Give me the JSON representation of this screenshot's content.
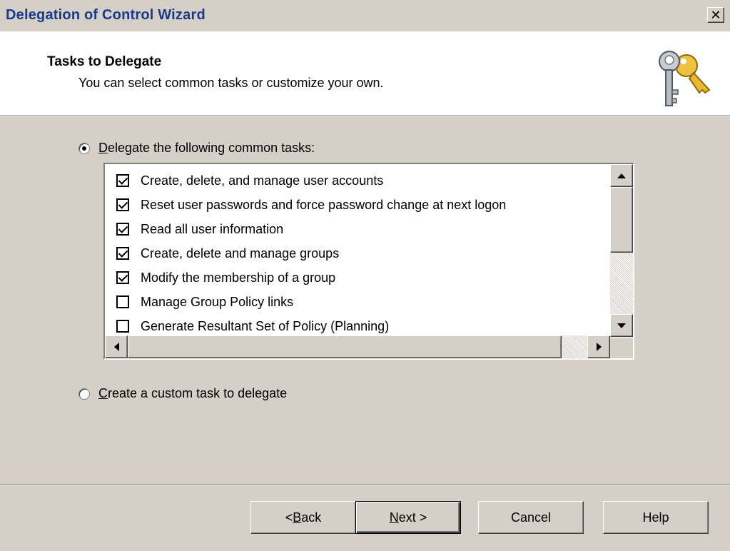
{
  "window": {
    "title": "Delegation of Control Wizard",
    "close_glyph": "✕"
  },
  "header": {
    "title": "Tasks to Delegate",
    "subtitle": "You can select common tasks or customize your own.",
    "icon": "keys-icon"
  },
  "options": {
    "common": {
      "accel": "D",
      "rest": "elegate the following common tasks:",
      "selected": true
    },
    "custom": {
      "accel": "C",
      "rest": "reate a custom task to delegate",
      "selected": false
    }
  },
  "tasks": [
    {
      "label": "Create, delete, and manage user accounts",
      "checked": true
    },
    {
      "label": "Reset user passwords and force password change at next logon",
      "checked": true
    },
    {
      "label": "Read all user information",
      "checked": true
    },
    {
      "label": "Create, delete and manage groups",
      "checked": true
    },
    {
      "label": "Modify the membership of a group",
      "checked": true
    },
    {
      "label": "Manage Group Policy links",
      "checked": false
    },
    {
      "label": "Generate Resultant Set of Policy (Planning)",
      "checked": false
    }
  ],
  "buttons": {
    "back_prefix": "< ",
    "back_accel": "B",
    "back_rest": "ack",
    "next_accel": "N",
    "next_rest": "ext >",
    "cancel": "Cancel",
    "help": "Help"
  }
}
